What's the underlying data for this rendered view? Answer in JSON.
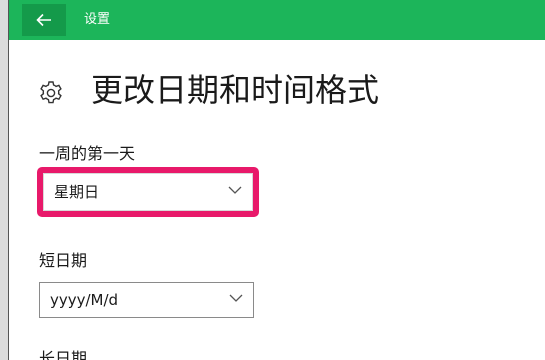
{
  "window": {
    "title": "设置",
    "back_icon": "back-arrow-icon",
    "accent_color": "#1cb55a"
  },
  "page": {
    "title": "更改日期和时间格式",
    "icon": "gear-icon"
  },
  "fields": {
    "first_day": {
      "label": "一周的第一天",
      "value": "星期日",
      "highlight_color": "#e8196a"
    },
    "short_date": {
      "label": "短日期",
      "value": "yyyy/M/d"
    },
    "long_date": {
      "label": "长日期"
    }
  }
}
